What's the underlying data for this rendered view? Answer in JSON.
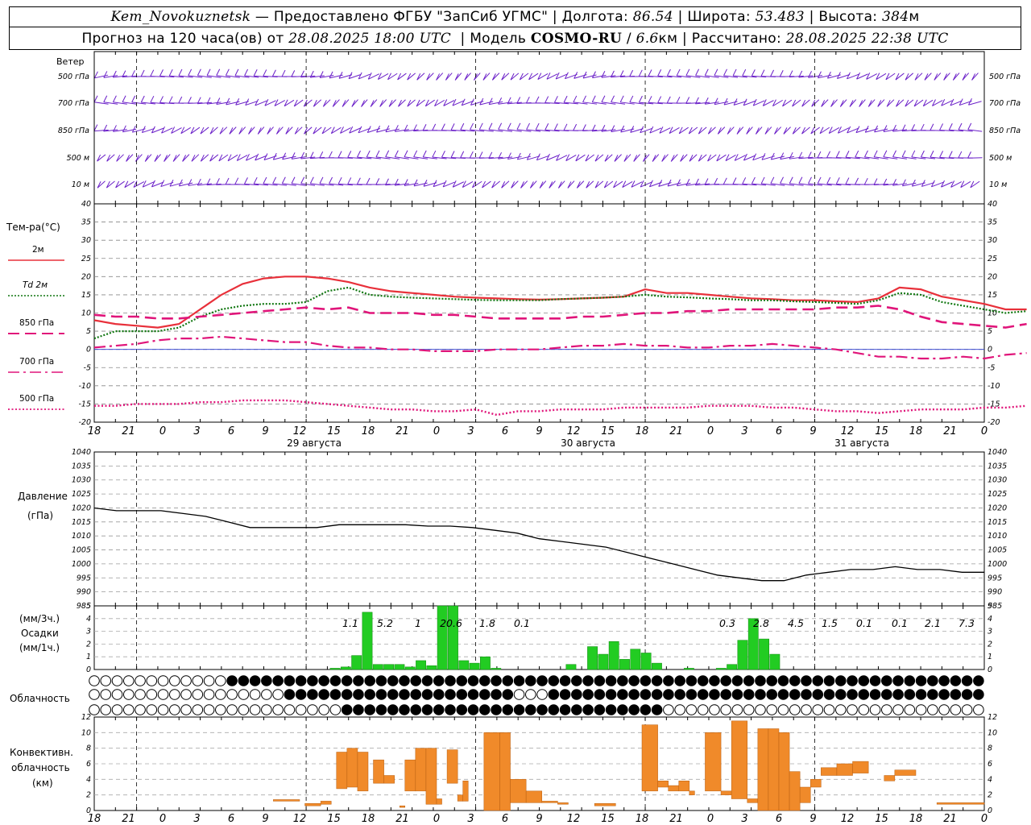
{
  "header": {
    "station": "Kem_Novokuznetsk",
    "provider": "— Предоставлено ФГБУ \"ЗапСиб УГМС\"",
    "lon_label": "Долгота:",
    "lon_value": "86.54",
    "lat_label": "Широта:",
    "lat_value": "53.483",
    "alt_label": "Высота:",
    "alt_value": "384",
    "alt_unit": "м",
    "forecast_label": "Прогноз на 120 часа(ов) от",
    "forecast_start": "28.08.2025 18:00 UTC",
    "model_label": "Модель",
    "model_name": "COSMO-RU",
    "model_res": "6.6",
    "model_res_unit": "км",
    "calc_label": "Рассчитано:",
    "calc_time": "28.08.2025 22:38 UTC"
  },
  "wind_panel": {
    "title": "Ветер",
    "levels": [
      "500 гПа",
      "700 гПа",
      "850 гПа",
      "500 м",
      "10 м"
    ]
  },
  "temp_panel": {
    "title": "Тем-ра(°С)",
    "legend": [
      {
        "label": "2м",
        "color": "#e8303a",
        "style": "solid"
      },
      {
        "label": "Td  2м",
        "color": "#117711",
        "style": "dotted"
      },
      {
        "label": "850 гПа",
        "color": "#e0157a",
        "style": "dashed"
      },
      {
        "label": "700 гПа",
        "color": "#e0157a",
        "style": "dashdot"
      },
      {
        "label": "500 гПа",
        "color": "#e0157a",
        "style": "dotted"
      }
    ]
  },
  "pressure_panel": {
    "title": "Давление",
    "unit": "(гПа)"
  },
  "precip_panel": {
    "unit3": "(мм/3ч.)",
    "title": "Осадки",
    "unit1": "(мм/1ч.)"
  },
  "cloud_panel": {
    "title": "Облачность"
  },
  "conv_panel": {
    "title1": "Конвективн.",
    "title2": "облачность",
    "unit": "(км)"
  },
  "time_axis": {
    "hour_labels": [
      "18",
      "21",
      "0",
      "3",
      "6",
      "9",
      "12",
      "15",
      "18",
      "21",
      "0",
      "3",
      "6",
      "9",
      "12",
      "15",
      "18",
      "21",
      "0",
      "3",
      "6",
      "9",
      "12",
      "15",
      "18",
      "21",
      "0"
    ],
    "day_labels": [
      "29 августа",
      "30 августа",
      "31 августа"
    ]
  },
  "chart_data": [
    {
      "type": "line",
      "panel": "temperature",
      "x_hours": [
        0,
        3,
        6,
        9,
        12,
        15,
        18,
        21,
        24,
        27,
        30,
        33,
        36,
        39,
        42,
        45,
        48,
        51,
        54,
        57,
        60,
        63,
        66,
        69,
        72,
        75,
        78,
        81,
        84,
        87,
        90,
        93,
        96,
        99,
        102,
        105,
        108,
        111,
        114,
        117,
        120,
        123,
        126,
        129,
        132
      ],
      "ylim": [
        -20,
        40
      ],
      "yticks": [
        -20,
        -15,
        -10,
        -5,
        0,
        5,
        10,
        15,
        20,
        25,
        30,
        35,
        40
      ],
      "series": [
        {
          "name": "2м",
          "values": [
            8,
            7,
            6.5,
            6,
            7,
            11,
            15,
            18,
            19.5,
            20,
            20,
            19.5,
            18.5,
            17,
            16,
            15.5,
            15,
            14.5,
            14.2,
            14,
            13.8,
            13.7,
            13.8,
            14,
            14.2,
            14.5,
            16.5,
            15.5,
            15.5,
            15,
            14.5,
            14,
            13.8,
            13.5,
            13.5,
            13.2,
            13,
            14,
            17,
            16.5,
            14.5,
            13.5,
            12.5,
            11,
            11
          ]
        },
        {
          "name": "Td  2м",
          "values": [
            3,
            5,
            5,
            5,
            6,
            9,
            11,
            12,
            12.5,
            12.5,
            13,
            16,
            17,
            15,
            14.5,
            14.2,
            14,
            13.8,
            13.6,
            13.5,
            13.5,
            13.5,
            13.8,
            14,
            14.2,
            14.5,
            15,
            14.5,
            14.3,
            14,
            13.8,
            13.5,
            13.5,
            13.2,
            13,
            12.8,
            12.5,
            13.5,
            15.5,
            15,
            13,
            12,
            11,
            10,
            10.5
          ]
        },
        {
          "name": "850 гПа",
          "values": [
            9.5,
            9,
            9,
            8.5,
            8.5,
            9,
            9.5,
            10,
            10.5,
            11,
            11.5,
            11,
            11.5,
            10,
            10,
            10,
            9.5,
            9.5,
            9,
            8.5,
            8.5,
            8.5,
            8.5,
            9,
            9,
            9.5,
            10,
            10,
            10.5,
            10.5,
            11,
            11,
            11,
            11,
            11,
            11.5,
            11.5,
            12,
            11,
            9,
            7.5,
            7,
            6.5,
            6,
            7
          ]
        },
        {
          "name": "700 гПа",
          "values": [
            0.5,
            1,
            1.5,
            2.5,
            3,
            3,
            3.5,
            3,
            2.5,
            2,
            2,
            1,
            0.5,
            0.5,
            0,
            0,
            -0.5,
            -0.5,
            -0.5,
            0,
            0,
            0,
            0.5,
            1,
            1,
            1.5,
            1,
            1,
            0.5,
            0.5,
            1,
            1,
            1.5,
            1,
            0.5,
            0,
            -1,
            -2,
            -2,
            -2.5,
            -2.5,
            -2,
            -2.5,
            -1.5,
            -1
          ]
        },
        {
          "name": "500 гПа",
          "values": [
            -15.5,
            -15.5,
            -15,
            -15,
            -15,
            -14.5,
            -14.5,
            -14,
            -14,
            -14,
            -14.5,
            -15,
            -15.5,
            -16,
            -16.5,
            -16.5,
            -17,
            -17,
            -16.5,
            -18,
            -17,
            -17,
            -16.5,
            -16.5,
            -16.5,
            -16,
            -16,
            -16,
            -16,
            -15.5,
            -15.5,
            -15.5,
            -16,
            -16,
            -16.5,
            -17,
            -17,
            -17.5,
            -17,
            -16.5,
            -16.5,
            -16.5,
            -16,
            -16,
            -15.5
          ]
        }
      ]
    },
    {
      "type": "line",
      "panel": "pressure",
      "ylim": [
        985,
        1040
      ],
      "yticks": [
        985,
        990,
        995,
        1000,
        1005,
        1010,
        1015,
        1020,
        1025,
        1030,
        1035,
        1040
      ],
      "x_hours": [
        0,
        3,
        6,
        9,
        12,
        15,
        18,
        21,
        24,
        27,
        30,
        33,
        36,
        39,
        42,
        45,
        48,
        51,
        54,
        57,
        60,
        63,
        66,
        69,
        72,
        75,
        78,
        81,
        84,
        87,
        90,
        93,
        96,
        99,
        102,
        105,
        108,
        111,
        114,
        117,
        120
      ],
      "series": [
        {
          "name": "Давление",
          "values": [
            1020,
            1019,
            1019,
            1019,
            1018,
            1017,
            1015,
            1013,
            1013,
            1013,
            1013,
            1014,
            1014,
            1014,
            1014,
            1013.5,
            1013.5,
            1013,
            1012,
            1011,
            1009,
            1008,
            1007,
            1006,
            1004,
            1002,
            1000,
            998,
            996,
            995,
            994,
            994,
            996,
            997,
            998,
            998,
            999,
            998,
            998,
            997,
            997
          ]
        }
      ]
    },
    {
      "type": "bar",
      "panel": "precipitation",
      "ylim": [
        0,
        5
      ],
      "yticks": [
        0,
        1,
        2,
        3,
        4,
        5
      ],
      "x_hours": [
        24,
        27,
        30,
        33,
        36,
        39,
        42,
        45,
        48,
        51,
        54,
        57,
        60,
        63,
        66,
        69,
        72,
        75,
        78,
        81,
        84,
        87,
        90,
        93,
        96,
        99,
        102,
        105,
        108,
        111,
        114,
        117,
        120
      ],
      "values": [
        0.1,
        0.2,
        1.1,
        4.5,
        0.4,
        0.4,
        0.4,
        0.2,
        0.7,
        0.3,
        5.5,
        5.5,
        0.7,
        0.5,
        1.0,
        0.1,
        0,
        0,
        0,
        0,
        0,
        0,
        0.4,
        0,
        1.8,
        1.2,
        2.2,
        0.8,
        1.6,
        1.3,
        0.5,
        0,
        0,
        0.1,
        0,
        0,
        0.1,
        0.4,
        2.3,
        4.0,
        2.4,
        1.2
      ],
      "labels": [
        {
          "text": "1.1"
        },
        {
          "text": "5.2"
        },
        {
          "text": "1"
        },
        {
          "text": "20.6"
        },
        {
          "text": "1.8"
        },
        {
          "text": "0.1"
        },
        {
          "text": "0.3"
        },
        {
          "text": "2.8"
        },
        {
          "text": "4.5"
        },
        {
          "text": "1.5"
        },
        {
          "text": "0.1"
        },
        {
          "text": "0.1"
        },
        {
          "text": "2.1"
        },
        {
          "text": "7.3"
        }
      ]
    },
    {
      "type": "bar",
      "panel": "convective_cloud",
      "ylim": [
        0,
        12
      ],
      "yticks": [
        0,
        2,
        4,
        6,
        8,
        10,
        12
      ],
      "segments": [
        {
          "x0": 68,
          "x1": 78,
          "y0": 1.2,
          "y1": 1.4
        },
        {
          "x0": 80,
          "x1": 86,
          "y0": 0.6,
          "y1": 0.9
        },
        {
          "x0": 86,
          "x1": 90,
          "y0": 0.8,
          "y1": 1.2
        },
        {
          "x0": 92,
          "x1": 96,
          "y0": 2.8,
          "y1": 7.5
        },
        {
          "x0": 96,
          "x1": 100,
          "y0": 3.0,
          "y1": 8.0
        },
        {
          "x0": 100,
          "x1": 104,
          "y0": 2.5,
          "y1": 7.5
        },
        {
          "x0": 106,
          "x1": 110,
          "y0": 3.5,
          "y1": 6.5
        },
        {
          "x0": 110,
          "x1": 114,
          "y0": 3.5,
          "y1": 4.5
        },
        {
          "x0": 116,
          "x1": 118,
          "y0": 0.4,
          "y1": 0.6
        },
        {
          "x0": 118,
          "x1": 122,
          "y0": 2.5,
          "y1": 6.5
        },
        {
          "x0": 122,
          "x1": 126,
          "y0": 2.5,
          "y1": 8.0
        },
        {
          "x0": 126,
          "x1": 130,
          "y0": 0.8,
          "y1": 8.0
        },
        {
          "x0": 130,
          "x1": 132,
          "y0": 0.8,
          "y1": 1.5
        },
        {
          "x0": 134,
          "x1": 138,
          "y0": 3.5,
          "y1": 7.8
        },
        {
          "x0": 138,
          "x1": 140,
          "y0": 1.2,
          "y1": 2.0
        },
        {
          "x0": 140,
          "x1": 142,
          "y0": 1.2,
          "y1": 3.8
        },
        {
          "x0": 148,
          "x1": 154,
          "y0": 0.0,
          "y1": 10.0
        },
        {
          "x0": 154,
          "x1": 158,
          "y0": 0.0,
          "y1": 10.0
        },
        {
          "x0": 158,
          "x1": 164,
          "y0": 1.0,
          "y1": 4.0
        },
        {
          "x0": 164,
          "x1": 170,
          "y0": 1.0,
          "y1": 2.5
        },
        {
          "x0": 170,
          "x1": 176,
          "y0": 1.0,
          "y1": 1.2
        },
        {
          "x0": 176,
          "x1": 180,
          "y0": 0.8,
          "y1": 1.0
        },
        {
          "x0": 190,
          "x1": 198,
          "y0": 0.6,
          "y1": 0.9
        },
        {
          "x0": 208,
          "x1": 214,
          "y0": 2.5,
          "y1": 11.0
        },
        {
          "x0": 214,
          "x1": 218,
          "y0": 3.0,
          "y1": 3.8
        },
        {
          "x0": 218,
          "x1": 222,
          "y0": 2.5,
          "y1": 3.2
        },
        {
          "x0": 222,
          "x1": 226,
          "y0": 2.5,
          "y1": 3.8
        },
        {
          "x0": 226,
          "x1": 228,
          "y0": 2.0,
          "y1": 2.5
        },
        {
          "x0": 232,
          "x1": 238,
          "y0": 2.5,
          "y1": 10.0
        },
        {
          "x0": 238,
          "x1": 242,
          "y0": 2.0,
          "y1": 2.5
        },
        {
          "x0": 242,
          "x1": 248,
          "y0": 1.5,
          "y1": 11.5
        },
        {
          "x0": 248,
          "x1": 252,
          "y0": 1.0,
          "y1": 1.5
        },
        {
          "x0": 252,
          "x1": 256,
          "y0": 0.0,
          "y1": 10.5
        },
        {
          "x0": 256,
          "x1": 260,
          "y0": 0.0,
          "y1": 10.5
        },
        {
          "x0": 260,
          "x1": 264,
          "y0": 0.0,
          "y1": 10.0
        },
        {
          "x0": 264,
          "x1": 268,
          "y0": 0.0,
          "y1": 5.0
        },
        {
          "x0": 268,
          "x1": 272,
          "y0": 1.0,
          "y1": 3.0
        },
        {
          "x0": 272,
          "x1": 276,
          "y0": 3.0,
          "y1": 4.0
        },
        {
          "x0": 276,
          "x1": 282,
          "y0": 4.5,
          "y1": 5.5
        },
        {
          "x0": 282,
          "x1": 288,
          "y0": 4.5,
          "y1": 6.0
        },
        {
          "x0": 288,
          "x1": 294,
          "y0": 4.8,
          "y1": 6.3
        },
        {
          "x0": 300,
          "x1": 304,
          "y0": 3.8,
          "y1": 4.5
        },
        {
          "x0": 304,
          "x1": 312,
          "y0": 4.5,
          "y1": 5.2
        },
        {
          "x0": 320,
          "x1": 338,
          "y0": 0.8,
          "y1": 1.0
        }
      ],
      "x_scale": "quarter_hours"
    }
  ]
}
